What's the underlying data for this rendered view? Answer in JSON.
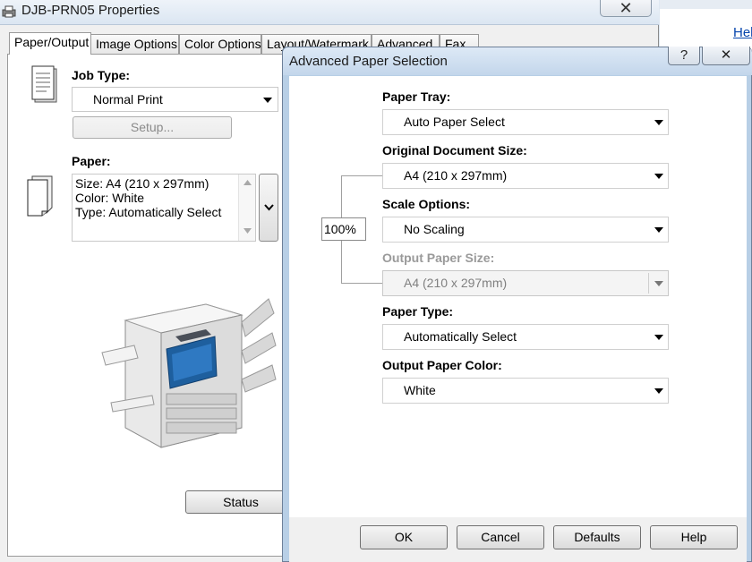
{
  "properties_window": {
    "title": "DJB-PRN05 Properties",
    "close_glyph": "✕",
    "tabs": [
      {
        "label": "Paper/Output"
      },
      {
        "label": "Image Options"
      },
      {
        "label": "Color Options"
      },
      {
        "label": "Layout/Watermark"
      },
      {
        "label": "Advanced"
      },
      {
        "label": "Fax"
      }
    ],
    "job_type": {
      "label": "Job Type:",
      "value": "Normal Print",
      "setup_label": "Setup..."
    },
    "paper": {
      "label": "Paper:",
      "lines": [
        "Size: A4 (210 x 297mm)",
        "Color: White",
        "Type: Automatically Select"
      ]
    },
    "status_label": "Status"
  },
  "background_link": {
    "help_label": "Help"
  },
  "advanced_dialog": {
    "title": "Advanced Paper Selection",
    "help_glyph": "?",
    "close_glyph": "✕",
    "paper_tray": {
      "label": "Paper Tray:",
      "value": "Auto Paper Select"
    },
    "original_size": {
      "label": "Original Document Size:",
      "value": "A4 (210 x 297mm)"
    },
    "scale_options": {
      "label": "Scale Options:",
      "value": "No Scaling",
      "percent": "100%"
    },
    "output_size": {
      "label": "Output Paper Size:",
      "value": "A4 (210 x 297mm)"
    },
    "paper_type": {
      "label": "Paper Type:",
      "value": "Automatically Select"
    },
    "output_color": {
      "label": "Output Paper Color:",
      "value": "White"
    },
    "buttons": {
      "ok": "OK",
      "cancel": "Cancel",
      "defaults": "Defaults",
      "help": "Help"
    }
  }
}
